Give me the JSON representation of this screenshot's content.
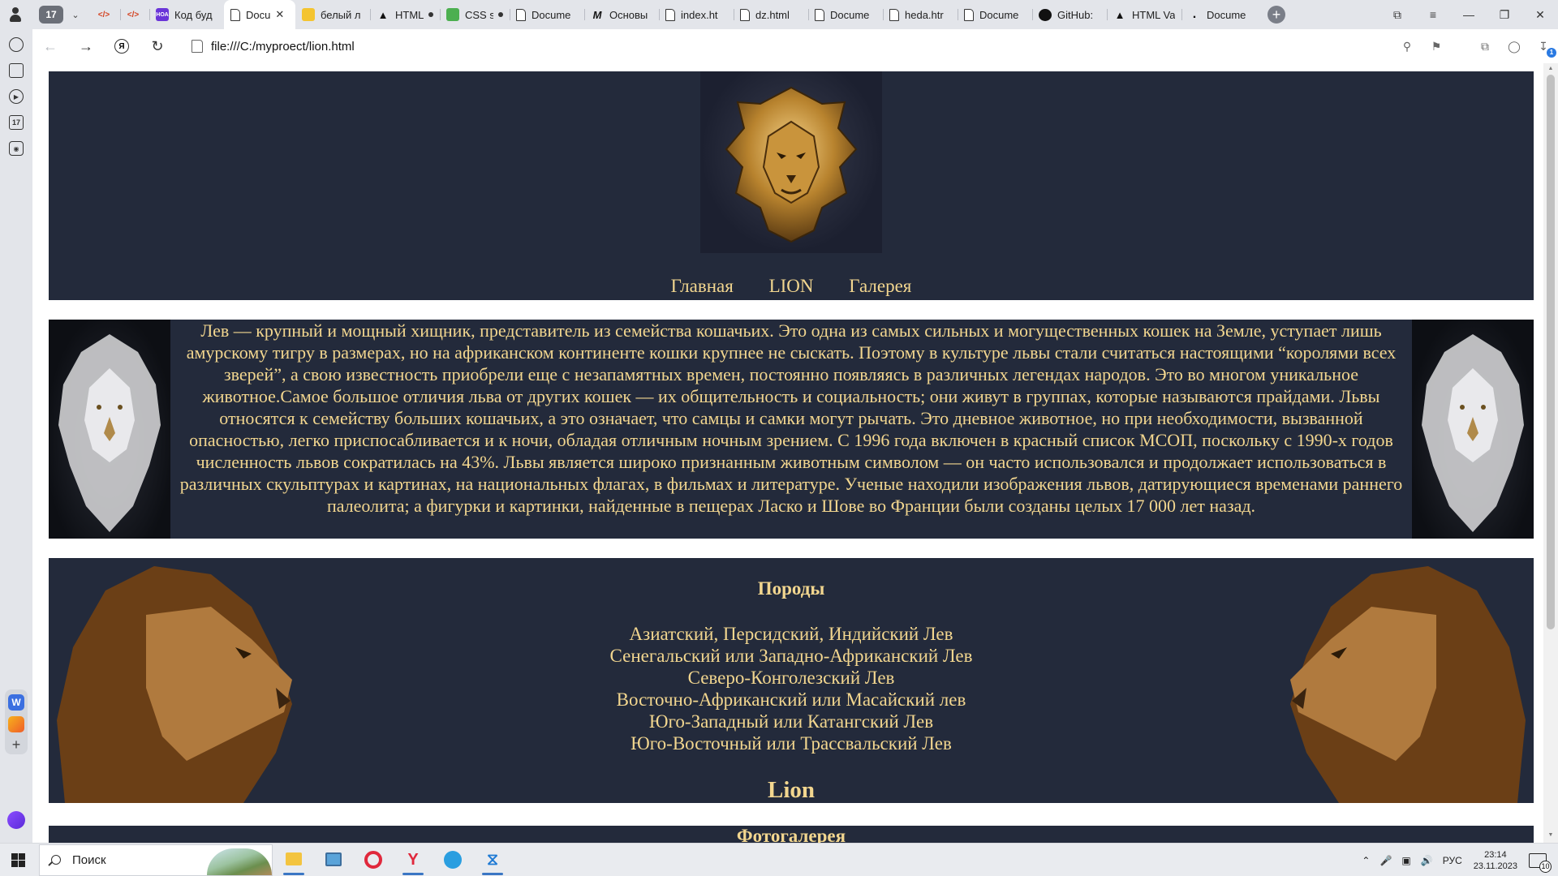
{
  "browser": {
    "tab_count": "17",
    "tabs": [
      {
        "label": "",
        "icon": "code-icon"
      },
      {
        "label": "",
        "icon": "code-icon"
      },
      {
        "label": "Код буд",
        "icon": "yandex-education-icon"
      },
      {
        "label": "Docu",
        "icon": "document-icon",
        "active": true
      },
      {
        "label": "белый л",
        "icon": "yellow-favicon"
      },
      {
        "label": "HTML",
        "icon": "triangle-icon"
      },
      {
        "label": "CSS s",
        "icon": "css-icon"
      },
      {
        "label": "Docume",
        "icon": "document-icon"
      },
      {
        "label": "Основы",
        "icon": "m-icon"
      },
      {
        "label": "index.ht",
        "icon": "document-icon"
      },
      {
        "label": "dz.html",
        "icon": "document-icon"
      },
      {
        "label": "Docume",
        "icon": "document-icon"
      },
      {
        "label": "heda.htr",
        "icon": "document-icon"
      },
      {
        "label": "Docume",
        "icon": "document-icon"
      },
      {
        "label": "GitHub:",
        "icon": "github-icon"
      },
      {
        "label": "HTML Va",
        "icon": "triangle-icon"
      },
      {
        "label": "Docume",
        "icon": "dot-icon"
      }
    ],
    "address": "file:///C:/myproect/lion.html",
    "downloads_badge": "1"
  },
  "page": {
    "nav": [
      "Главная",
      "LION",
      "Галерея"
    ],
    "about_text": "Лев — крупный и мощный хищник, представитель из семейства кошачьих. Это одна из самых сильных и могущественных кошек на Земле, уступает лишь амурскому тигру в размерах, но на африканском континенте кошки крупнее не сыскать. Поэтому в культуре львы стали считаться настоящими “королями всех зверей”, а свою известность приобрели еще с незапамятных времен, постоянно появляясь в различных легендах народов. Это во многом уникальное животное.Самое большое отличия льва от других кошек — их общительность и социальность; они живут в группах, которые называются прайдами. Львы относятся к семейству больших кошачьих, а это означает, что самцы и самки могут рычать. Это дневное животное, но при необходимости, вызванной опасностью, легко приспосабливается и к ночи, обладая отличным ночным зрением. С 1996 года включен в красный список МСОП, поскольку с 1990-х годов численность львов сократилась на 43%. Львы является широко признанным животным символом — он часто использовался и продолжает использоваться в различных скульптурах и картинах, на национальных флагах, в фильмах и литературе. Ученые находили изображения львов, датирующиеся временами раннего палеолита; а фигурки и картинки, найденные в пещерах Ласко и Шове во Франции были созданы целых 17 000 лет назад.",
    "breeds_title": "Породы",
    "breeds": [
      "Азиатский, Персидский, Индийский Лев",
      "Сенегальский или Западно-Африканский Лев",
      "Северо-Конголезский Лев",
      "Восточно-Африканский или Масайский лев",
      "Юго-Западный или Катангский Лев",
      "Юго-Восточный или Трассвальский Лев"
    ],
    "breeds_sign": "Lion",
    "gallery_title": "Фотогалерея",
    "colors": {
      "panel": "#232a3b",
      "text": "#f2d68f"
    }
  },
  "taskbar": {
    "search_placeholder": "Поиск",
    "language": "РУС",
    "time": "23:14",
    "date": "23.11.2023",
    "notifications": "10"
  }
}
